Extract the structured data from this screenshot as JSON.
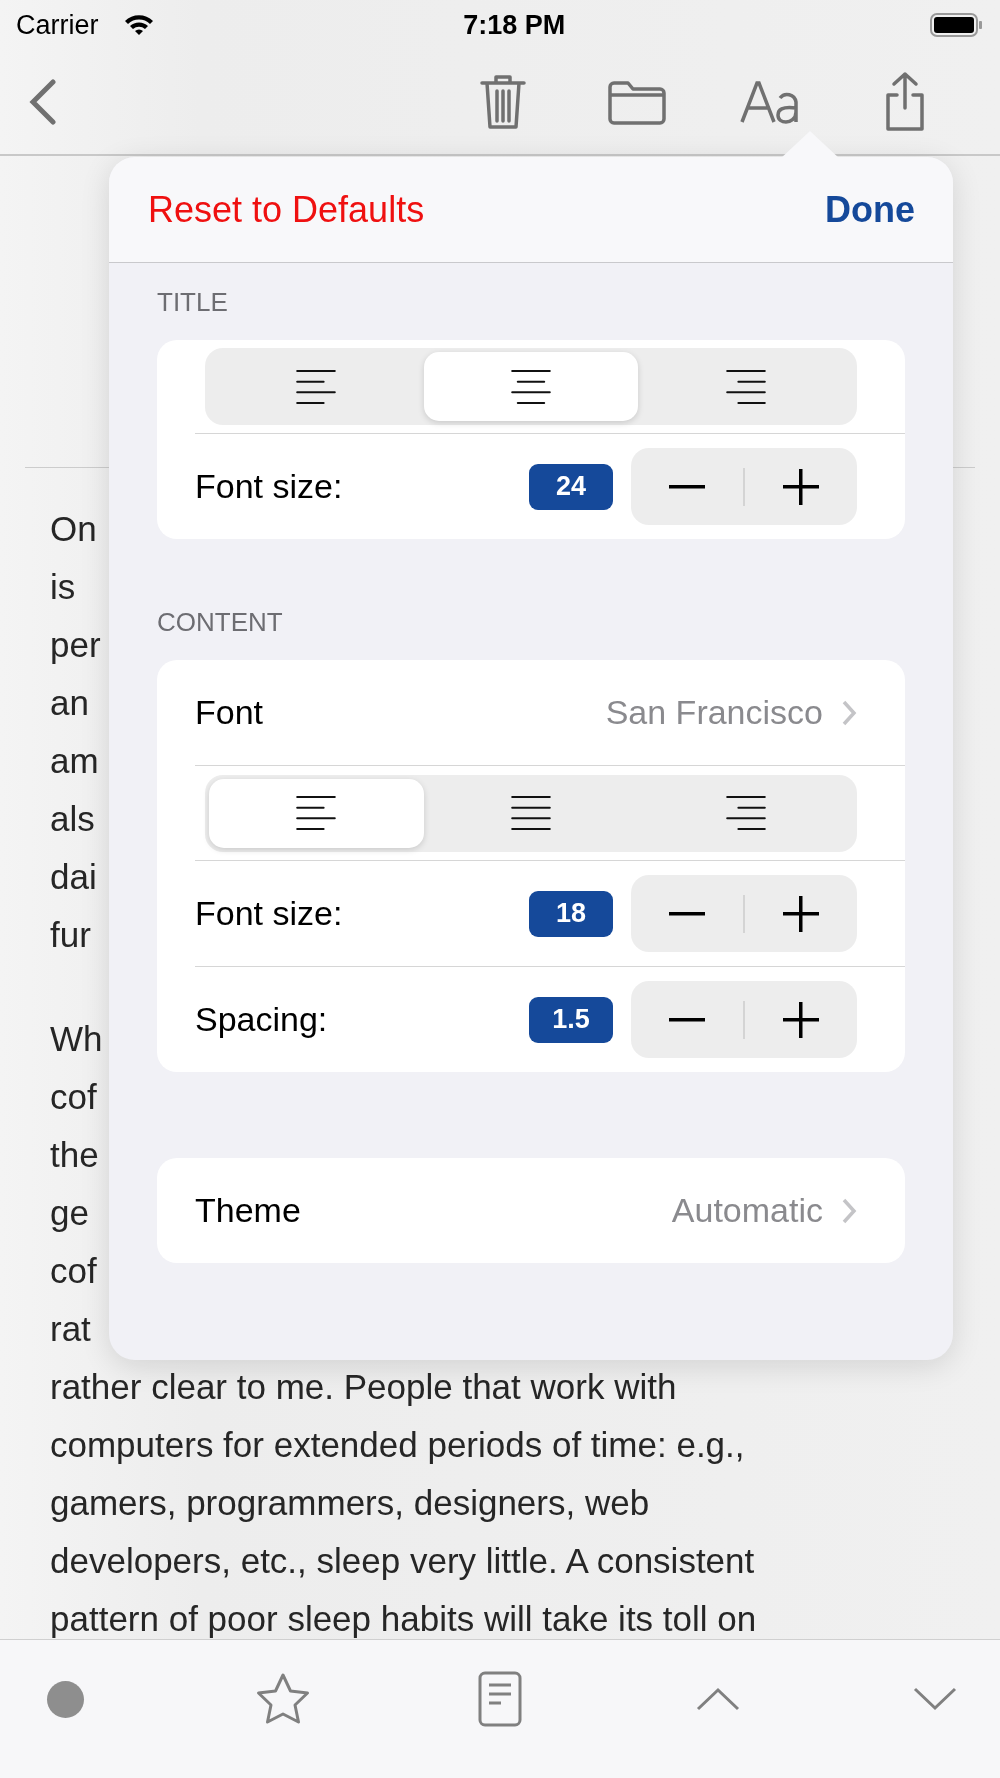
{
  "status_bar": {
    "carrier": "Carrier",
    "time": "7:18 PM"
  },
  "article": {
    "fragments": [
      [
        "On",
        "is",
        "per",
        "an",
        "am",
        "als",
        "dai",
        "fur"
      ],
      [
        "Wh",
        "cof",
        "the",
        "ge",
        "cof",
        "rat"
      ]
    ],
    "lines": [
      "rather clear to me. People that work with",
      "computers for extended periods of time: e.g.,",
      "gamers, programmers, designers, web",
      "developers, etc., sleep very little. A consistent",
      "pattern of poor sleep habits will take its toll on"
    ]
  },
  "popover": {
    "reset": "Reset to Defaults",
    "done": "Done",
    "title_section": {
      "heading": "TITLE",
      "alignment": [
        {
          "kind": "left",
          "selected": false
        },
        {
          "kind": "center",
          "selected": true
        },
        {
          "kind": "right",
          "selected": false
        }
      ],
      "font_size": {
        "label": "Font size:",
        "value": "24"
      }
    },
    "content_section": {
      "heading": "CONTENT",
      "font": {
        "label": "Font",
        "value": "San Francisco"
      },
      "alignment": [
        {
          "kind": "left",
          "selected": true
        },
        {
          "kind": "justify",
          "selected": false
        },
        {
          "kind": "right",
          "selected": false
        }
      ],
      "font_size": {
        "label": "Font size:",
        "value": "18"
      },
      "spacing": {
        "label": "Spacing:",
        "value": "1.5"
      }
    },
    "theme": {
      "label": "Theme",
      "value": "Automatic"
    }
  }
}
